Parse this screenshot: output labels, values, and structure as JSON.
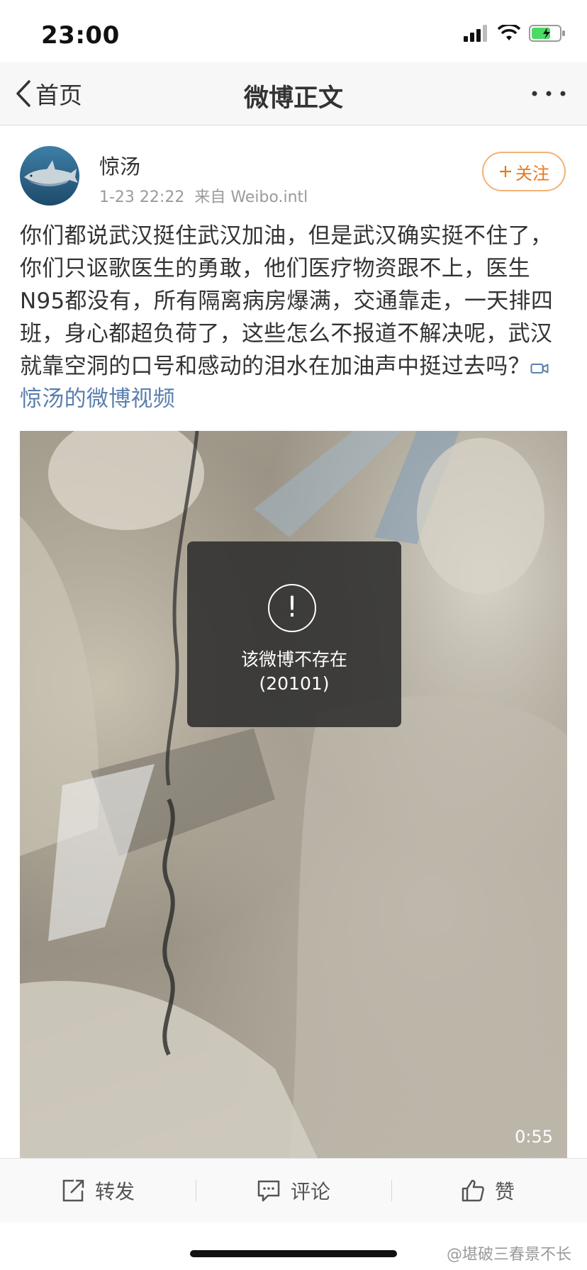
{
  "status_bar": {
    "time": "23:00"
  },
  "nav": {
    "back_label": "首页",
    "title": "微博正文",
    "more_icon": "more-icon"
  },
  "post": {
    "author": "惊汤",
    "timestamp": "1-23 22:22",
    "source": "来自 Weibo.intl",
    "follow_label": "关注",
    "text": "你们都说武汉挺住武汉加油，但是武汉确实挺不住了，你们只讴歌医生的勇敢，他们医疗物资跟不上，医生N95都没有，所有隔离病房爆满，交通靠走，一天排四班，身心都超负荷了，这些怎么不报道不解决呢，武汉就靠空洞的口号和感动的泪水在加油声中挺过去吗？",
    "video_link": "惊汤的微博视频"
  },
  "video": {
    "error_message": "该微博不存在",
    "error_code": "(20101)",
    "duration": "0:55"
  },
  "actions": {
    "repost": "转发",
    "comment": "评论",
    "like": "赞"
  },
  "watermark": "@堪破三春景不长",
  "colors": {
    "accent": "#e8791b",
    "link": "#5a7fae"
  }
}
